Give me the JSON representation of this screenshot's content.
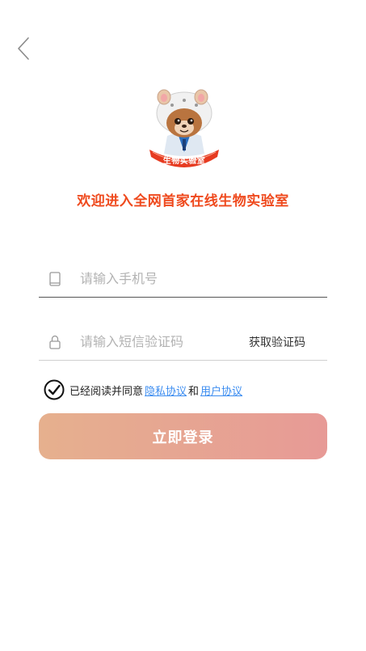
{
  "header": {
    "back_icon": "chevron-left-icon"
  },
  "logo": {
    "badge_text": "生物实验室"
  },
  "welcome": {
    "title": "欢迎进入全网首家在线生物实验室"
  },
  "form": {
    "phone": {
      "icon": "phone-icon",
      "placeholder": "请输入手机号",
      "value": ""
    },
    "code": {
      "icon": "lock-icon",
      "placeholder": "请输入短信验证码",
      "value": "",
      "get_code_label": "获取验证码"
    }
  },
  "agreement": {
    "checked": true,
    "prefix": "已经阅读并同意",
    "privacy_link": "隐私协议",
    "and": "和",
    "user_link": "用户协议"
  },
  "login_button": {
    "label": "立即登录"
  },
  "colors": {
    "accent": "#ef4a1e",
    "link": "#3b8cf0",
    "button_gradient_start": "#e6b08e",
    "button_gradient_end": "#e79a96"
  }
}
